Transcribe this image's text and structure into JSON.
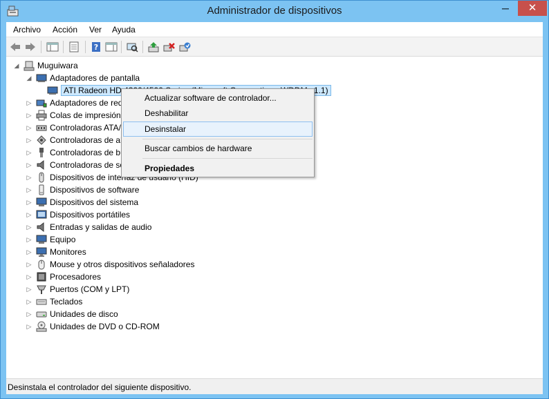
{
  "window": {
    "title": "Administrador de dispositivos",
    "minimize_glyph": "─",
    "close_glyph": "✕"
  },
  "menubar": {
    "items": [
      "Archivo",
      "Acción",
      "Ver",
      "Ayuda"
    ]
  },
  "toolbar": {
    "buttons": [
      "back-arrow-icon",
      "forward-arrow-icon",
      "console-tree-icon",
      "properties-icon",
      "help-icon",
      "action-pane-icon",
      "scan-hardware-icon",
      "update-driver-icon",
      "uninstall-icon",
      "enable-device-icon"
    ]
  },
  "tree": {
    "root": "Muguiwara",
    "expanded_category": "Adaptadores de pantalla",
    "selected_device": "ATI Radeon HD 4300/4500 Series (Microsoft Corporation - WDDM v1.1)",
    "categories": [
      "Adaptadores de red",
      "Colas de impresión",
      "Controladoras ATA/ATAPI IDE",
      "Controladoras de almacenamiento",
      "Controladoras de bus serie universal",
      "Controladoras de sonido y vídeo y dispositivos de juego",
      "Dispositivos de interfaz de usuario (HID)",
      "Dispositivos de software",
      "Dispositivos del sistema",
      "Dispositivos portátiles",
      "Entradas y salidas de audio",
      "Equipo",
      "Monitores",
      "Mouse y otros dispositivos señaladores",
      "Procesadores",
      "Puertos (COM y LPT)",
      "Teclados",
      "Unidades de disco",
      "Unidades de DVD o CD-ROM"
    ]
  },
  "context_menu": {
    "update_driver": "Actualizar software de controlador...",
    "disable": "Deshabilitar",
    "uninstall": "Desinstalar",
    "scan": "Buscar cambios de hardware",
    "properties": "Propiedades"
  },
  "statusbar": {
    "text": "Desinstala el controlador del siguiente dispositivo."
  },
  "colors": {
    "title_bar": "#7cc3f2",
    "close_button": "#c7504b",
    "selection": "#cce8ff",
    "menu_hover_border": "#8dbff0"
  }
}
